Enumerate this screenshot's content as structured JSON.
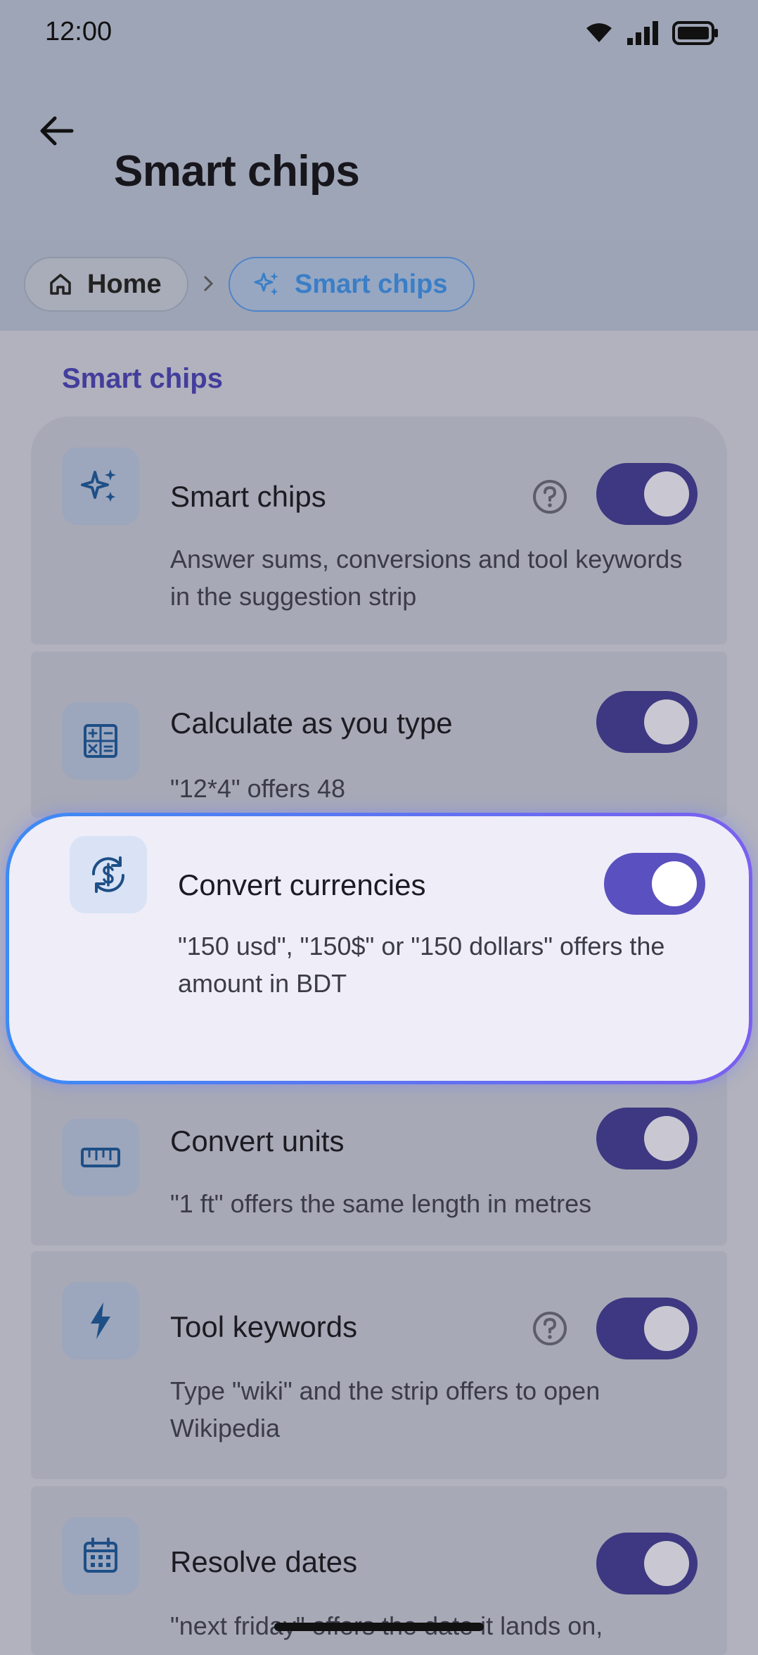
{
  "status_bar": {
    "time": "12:00"
  },
  "header": {
    "title": "Smart chips"
  },
  "breadcrumb": {
    "home": "Home",
    "current": "Smart chips"
  },
  "section": {
    "title": "Smart chips"
  },
  "items": [
    {
      "title": "Smart chips",
      "description": "Answer sums, conversions and tool keywords in the suggestion strip",
      "enabled": true,
      "has_help": true,
      "icon": "sparkle-icon"
    },
    {
      "title": "Calculate as you type",
      "description": "\"12*4\" offers 48",
      "enabled": true,
      "has_help": false,
      "icon": "calculator-icon"
    },
    {
      "title": "Convert currencies",
      "description": "\"150 usd\", \"150$\" or \"150 dollars\" offers the amount in BDT",
      "enabled": true,
      "has_help": false,
      "icon": "currency-exchange-icon",
      "highlighted": true
    },
    {
      "title": "Convert units",
      "description": "\"1 ft\" offers the same length in metres",
      "enabled": true,
      "has_help": false,
      "icon": "ruler-icon"
    },
    {
      "title": "Tool keywords",
      "description": "Type \"wiki\" and the strip offers to open Wikipedia",
      "enabled": true,
      "has_help": true,
      "icon": "bolt-icon"
    },
    {
      "title": "Resolve dates",
      "description": "\"next friday\" offers the date it lands on,",
      "enabled": true,
      "has_help": false,
      "icon": "calendar-icon"
    }
  ],
  "colors": {
    "accent": "#3d3881",
    "section_title": "#433d9c",
    "highlight_border_start": "#3d8bf5",
    "highlight_border_end": "#7b5ff0"
  }
}
